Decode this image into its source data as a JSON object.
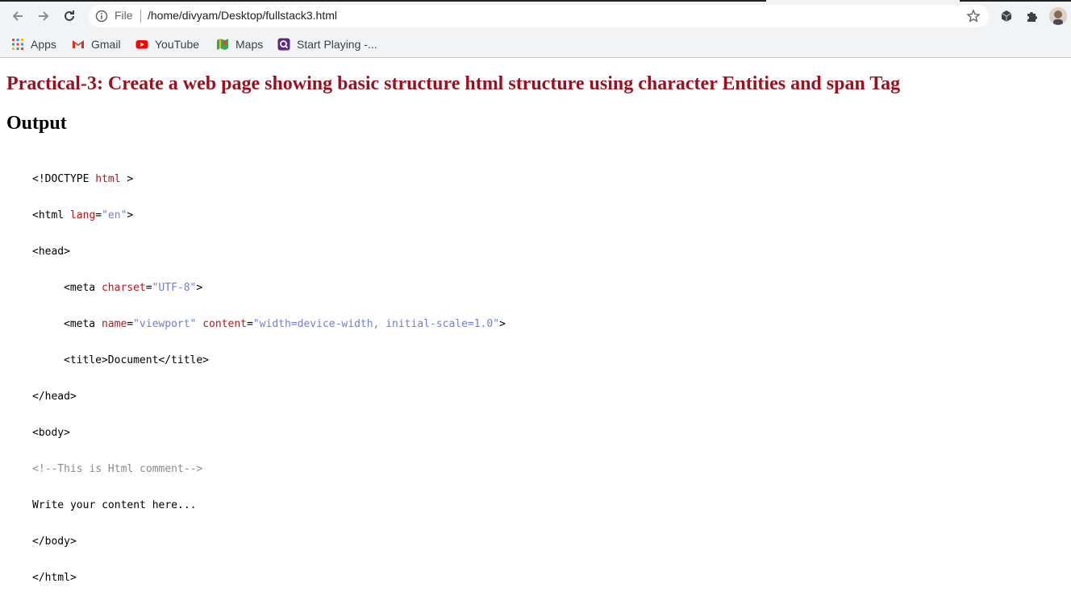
{
  "browser": {
    "omnibox": {
      "scheme_label": "File",
      "url": "/home/divyam/Desktop/fullstack3.html"
    },
    "bookmarks": [
      {
        "label": "Apps",
        "icon": "apps-grid-icon"
      },
      {
        "label": "Gmail",
        "icon": "gmail-icon"
      },
      {
        "label": "YouTube",
        "icon": "youtube-icon"
      },
      {
        "label": "Maps",
        "icon": "maps-icon"
      },
      {
        "label": "Start Playing -...",
        "icon": "game-icon"
      }
    ]
  },
  "page": {
    "heading": "Practical-3: Create a web page showing basic structure html structure using character Entities and span Tag",
    "subheading": "Output",
    "code": {
      "doctype_open": "<!DOCTYPE ",
      "doctype_kw": "html",
      "doctype_close": " >",
      "html_open": "<html ",
      "html_attr": "lang",
      "html_eq": "=",
      "html_val": "\"en\"",
      "html_close": ">",
      "head_open": "<head>",
      "meta1_open": "<meta ",
      "meta1_attr": "charset",
      "meta1_eq": "=",
      "meta1_val": "\"UTF-8\"",
      "meta1_close": ">",
      "meta2_open": "<meta ",
      "meta2_attr1": "name",
      "meta2_eq1": "=",
      "meta2_val1": "\"viewport\"",
      "meta2_sp": " ",
      "meta2_attr2": "content",
      "meta2_eq2": "=",
      "meta2_val2": "\"width=device-width, initial-scale=1.0\"",
      "meta2_close": ">",
      "title_line": "<title>Document</title>",
      "head_close": "</head>",
      "body_open": "<body>",
      "comment": "<!--This is Html comment-->",
      "content": "Write your content here...",
      "body_close": "</body>",
      "html_end": "</html>"
    }
  },
  "colors": {
    "heading": "#9b0f1f",
    "attr": "#b5161b",
    "value": "#6e7fd8",
    "comment": "#8a8a8a"
  }
}
